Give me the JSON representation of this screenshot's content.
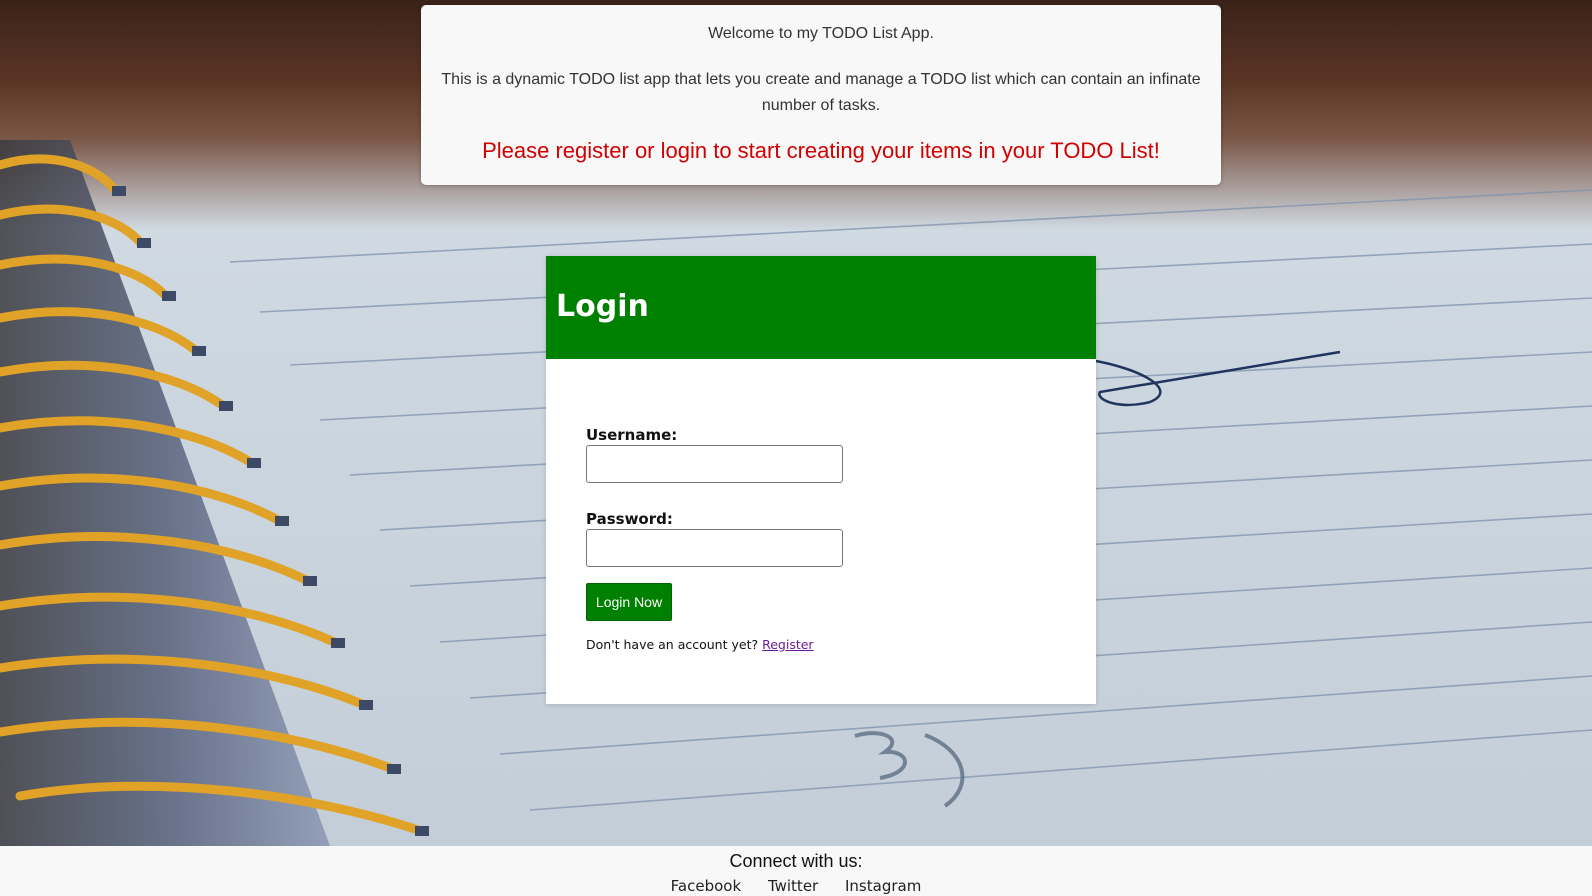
{
  "welcome": {
    "line1": "Welcome to my TODO List App.",
    "line2": "This is a dynamic TODO list app that lets you create and manage a TODO list which can contain an infinate number of tasks.",
    "cta": "Please register or login to start creating your items in your TODO List!"
  },
  "login": {
    "title": "Login",
    "username_label": "Username:",
    "username_value": "",
    "password_label": "Password:",
    "password_value": "",
    "submit_label": "Login Now",
    "no_account_text": "Don't have an account yet?",
    "register_link": "Register"
  },
  "footer": {
    "title": "Connect with us:",
    "links": [
      "Facebook",
      "Twitter",
      "Instagram"
    ]
  },
  "colors": {
    "header_green": "#008000",
    "cta_red": "#d10000",
    "link_purple": "#6a1b9a",
    "banner_bg": "#f8f8f8"
  },
  "icons": {
    "background": "spiral-notebook-photo"
  }
}
